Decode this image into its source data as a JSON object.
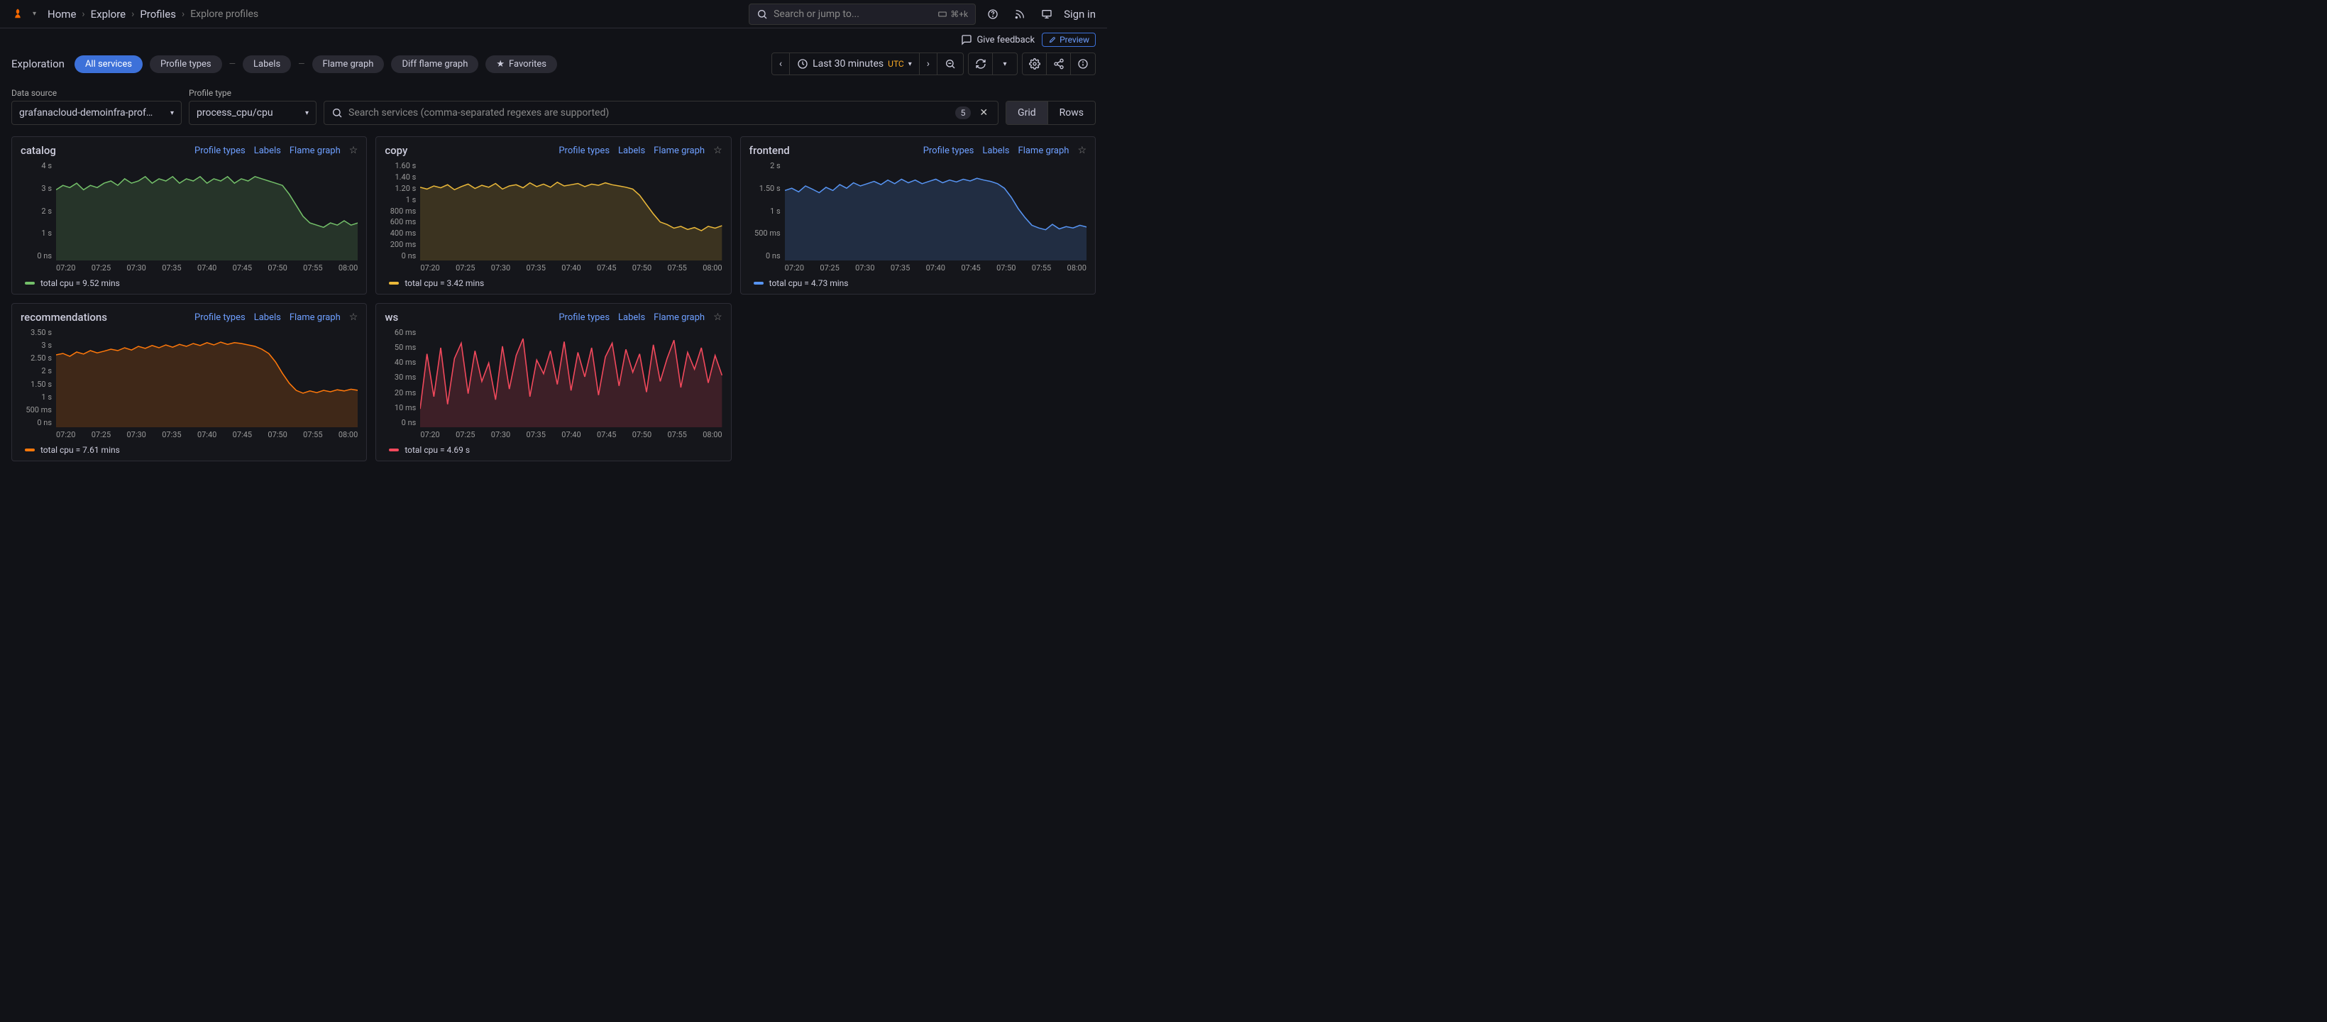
{
  "breadcrumb": {
    "home": "Home",
    "explore": "Explore",
    "profiles": "Profiles",
    "current": "Explore profiles"
  },
  "topsearch": {
    "placeholder": "Search or jump to...",
    "kbd": "⌘+k"
  },
  "signin": "Sign in",
  "feedback": "Give feedback",
  "preview": "Preview",
  "exploration_label": "Exploration",
  "tabs": {
    "all_services": "All services",
    "profile_types": "Profile types",
    "labels": "Labels",
    "flame_graph": "Flame graph",
    "diff_flame": "Diff flame graph",
    "favorites": "Favorites"
  },
  "time": {
    "label": "Last 30 minutes",
    "tz": "UTC"
  },
  "controls": {
    "datasource_label": "Data source",
    "datasource_value": "grafanacloud-demoinfra-prof…",
    "profile_type_label": "Profile type",
    "profile_type_value": "process_cpu/cpu",
    "search_placeholder": "Search services (comma-separated regexes are supported)",
    "count": "5",
    "grid": "Grid",
    "rows": "Rows"
  },
  "panel_links": {
    "profile_types": "Profile types",
    "labels": "Labels",
    "flame_graph": "Flame graph"
  },
  "xticks": [
    "07:20",
    "07:25",
    "07:30",
    "07:35",
    "07:40",
    "07:45",
    "07:50",
    "07:55",
    "08:00"
  ],
  "chart_data": [
    {
      "name": "catalog",
      "color": "#73bf69",
      "legend": "total cpu = 9.52 mins",
      "yticks": [
        "4 s",
        "3 s",
        "2 s",
        "1 s",
        "0 ns"
      ],
      "ymax": 4.5,
      "series": [
        3.2,
        3.4,
        3.3,
        3.5,
        3.2,
        3.4,
        3.3,
        3.5,
        3.6,
        3.4,
        3.7,
        3.5,
        3.6,
        3.8,
        3.5,
        3.7,
        3.6,
        3.8,
        3.5,
        3.7,
        3.6,
        3.8,
        3.5,
        3.7,
        3.6,
        3.8,
        3.5,
        3.7,
        3.6,
        3.8,
        3.7,
        3.6,
        3.5,
        3.4,
        3.0,
        2.5,
        2.0,
        1.7,
        1.6,
        1.5,
        1.7,
        1.6,
        1.8,
        1.6,
        1.7
      ]
    },
    {
      "name": "copy",
      "color": "#eab839",
      "legend": "total cpu = 3.42 mins",
      "yticks": [
        "1.60 s",
        "1.40 s",
        "1.20 s",
        "1 s",
        "800 ms",
        "600 ms",
        "400 ms",
        "200 ms",
        "0 ns"
      ],
      "ymax": 1.6,
      "series": [
        1.18,
        1.15,
        1.2,
        1.17,
        1.22,
        1.14,
        1.19,
        1.23,
        1.16,
        1.21,
        1.18,
        1.24,
        1.15,
        1.2,
        1.22,
        1.17,
        1.25,
        1.19,
        1.23,
        1.18,
        1.26,
        1.2,
        1.22,
        1.24,
        1.19,
        1.23,
        1.21,
        1.25,
        1.22,
        1.2,
        1.18,
        1.15,
        1.05,
        0.9,
        0.75,
        0.62,
        0.58,
        0.52,
        0.55,
        0.5,
        0.53,
        0.48,
        0.55,
        0.52,
        0.56
      ]
    },
    {
      "name": "frontend",
      "color": "#5794f2",
      "legend": "total cpu = 4.73 mins",
      "yticks": [
        "2 s",
        "1.50 s",
        "1 s",
        "500 ms",
        "0 ns"
      ],
      "ymax": 2.2,
      "series": [
        1.55,
        1.6,
        1.52,
        1.65,
        1.58,
        1.5,
        1.62,
        1.55,
        1.68,
        1.6,
        1.72,
        1.65,
        1.7,
        1.75,
        1.68,
        1.78,
        1.7,
        1.8,
        1.72,
        1.78,
        1.7,
        1.75,
        1.8,
        1.72,
        1.78,
        1.74,
        1.8,
        1.76,
        1.82,
        1.78,
        1.75,
        1.7,
        1.6,
        1.4,
        1.15,
        0.95,
        0.78,
        0.72,
        0.68,
        0.8,
        0.7,
        0.75,
        0.72,
        0.78,
        0.74
      ]
    },
    {
      "name": "recommendations",
      "color": "#ff780a",
      "legend": "total cpu = 7.61 mins",
      "yticks": [
        "3.50 s",
        "3 s",
        "2.50 s",
        "2 s",
        "1.50 s",
        "1 s",
        "500 ms",
        "0 ns"
      ],
      "ymax": 3.5,
      "series": [
        2.55,
        2.6,
        2.5,
        2.65,
        2.58,
        2.7,
        2.62,
        2.68,
        2.75,
        2.7,
        2.8,
        2.72,
        2.85,
        2.78,
        2.88,
        2.8,
        2.9,
        2.82,
        2.92,
        2.85,
        2.95,
        2.88,
        2.98,
        2.9,
        3.0,
        2.92,
        2.98,
        2.95,
        2.9,
        2.85,
        2.75,
        2.6,
        2.3,
        1.9,
        1.55,
        1.3,
        1.2,
        1.28,
        1.22,
        1.3,
        1.25,
        1.32,
        1.28,
        1.34,
        1.3
      ]
    },
    {
      "name": "ws",
      "color": "#f2495c",
      "legend": "total cpu = 4.69 s",
      "yticks": [
        "60 ms",
        "50 ms",
        "40 ms",
        "30 ms",
        "20 ms",
        "10 ms",
        "0 ns"
      ],
      "ymax": 65,
      "series": [
        12,
        48,
        20,
        52,
        15,
        45,
        55,
        22,
        50,
        30,
        42,
        18,
        53,
        25,
        47,
        58,
        20,
        44,
        35,
        50,
        28,
        56,
        24,
        49,
        33,
        52,
        21,
        46,
        55,
        27,
        51,
        36,
        48,
        23,
        54,
        30,
        45,
        57,
        26,
        49,
        38,
        52,
        29,
        47,
        34
      ]
    }
  ]
}
